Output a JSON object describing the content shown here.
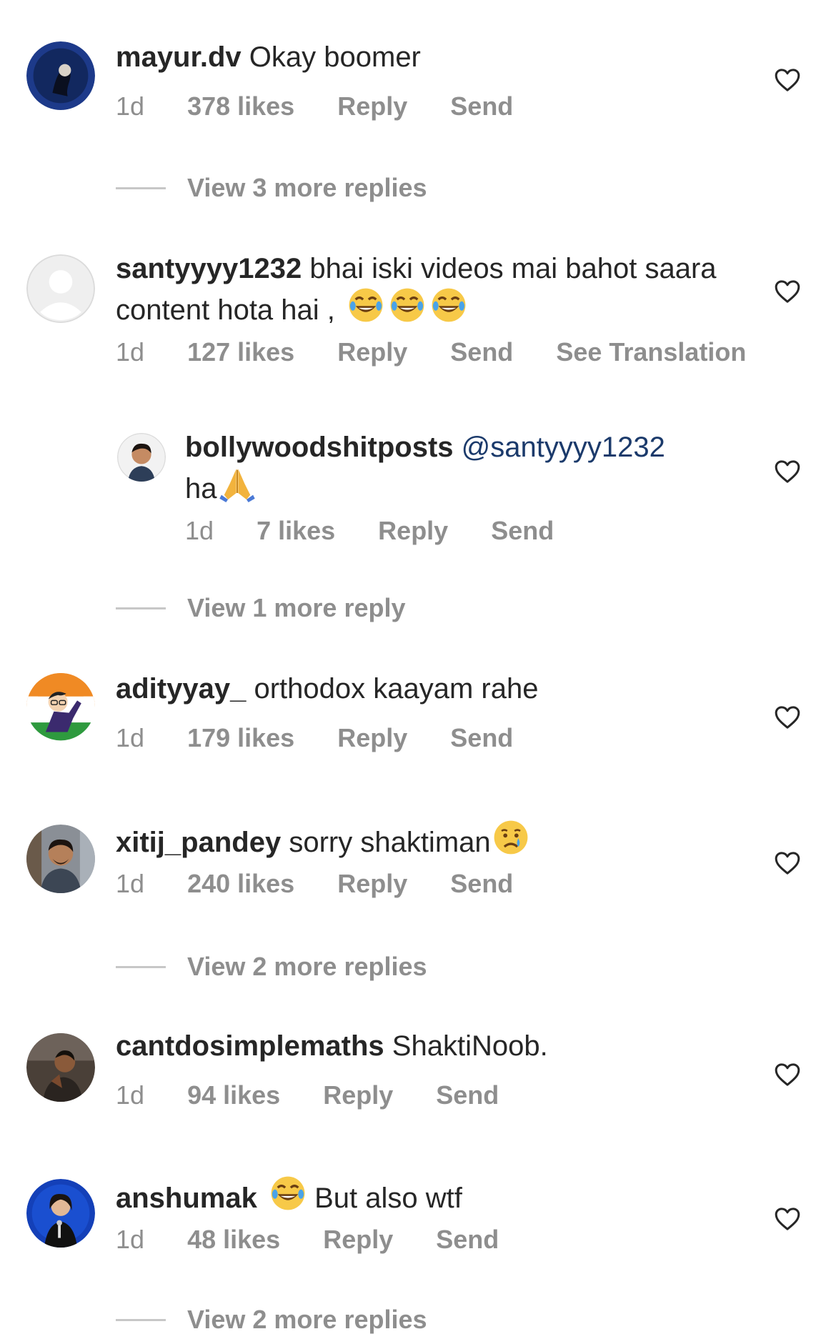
{
  "comments": [
    {
      "username": "mayur.dv",
      "text": "Okay boomer",
      "time": "1d",
      "likes": "378 likes",
      "reply": "Reply",
      "send": "Send",
      "avatar_icon": "avatar-dark-blue",
      "heart_icon": "heart-outline-icon"
    },
    {
      "username": "santyyyy1232",
      "text": "bhai iski videos mai bahot saara content hota hai ,",
      "emojis": [
        "joy-emoji",
        "joy-emoji",
        "joy-emoji"
      ],
      "time": "1d",
      "likes": "127 likes",
      "reply": "Reply",
      "send": "Send",
      "translate": "See Translation",
      "avatar_icon": "default-avatar-icon"
    },
    {
      "username": "bollywoodshitposts",
      "mention": "@santyyyy1232",
      "text": "ha",
      "emojis": [
        "folded-hands-emoji"
      ],
      "time": "1d",
      "likes": "7 likes",
      "reply": "Reply",
      "send": "Send"
    },
    {
      "username": "adityyay_",
      "text": "orthodox kaayam rahe",
      "time": "1d",
      "likes": "179 likes",
      "reply": "Reply",
      "send": "Send"
    },
    {
      "username": "xitij_pandey",
      "text": "sorry shaktiman",
      "emojis": [
        "crying-face-emoji"
      ],
      "time": "1d",
      "likes": "240 likes",
      "reply": "Reply",
      "send": "Send"
    },
    {
      "username": "cantdosimplemaths",
      "text": "ShaktiNoob.",
      "time": "1d",
      "likes": "94 likes",
      "reply": "Reply",
      "send": "Send"
    },
    {
      "username": "anshumak",
      "text": "But also wtf",
      "emojis": [
        "joy-emoji"
      ],
      "time": "1d",
      "likes": "48 likes",
      "reply": "Reply",
      "send": "Send"
    }
  ],
  "view_more": {
    "after_mayur": "View 3 more replies",
    "after_santyyyy": "View 1 more reply",
    "after_xitij": "View 2 more replies",
    "after_anshumak": "View 2 more replies"
  },
  "colors": {
    "text": "#262626",
    "meta": "#8e8e8e",
    "mention": "#1b3a6b",
    "divider": "#c7c7c7"
  }
}
